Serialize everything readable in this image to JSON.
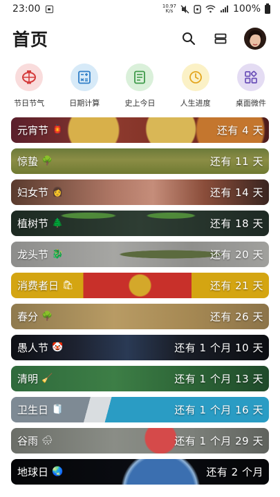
{
  "status_bar": {
    "time": "23:00",
    "net_speed_top": "10.97",
    "net_speed_bottom": "K/s",
    "battery": "100%"
  },
  "header": {
    "title": "首页"
  },
  "quick_actions": [
    {
      "label": "节日节气",
      "icon": "lantern-icon",
      "color": "#f6d9d9"
    },
    {
      "label": "日期计算",
      "icon": "calculator-icon",
      "color": "#d7e9f7"
    },
    {
      "label": "史上今日",
      "icon": "document-icon",
      "color": "#d9efd9"
    },
    {
      "label": "人生进度",
      "icon": "clock-icon",
      "color": "#faf0c8"
    },
    {
      "label": "桌面微件",
      "icon": "widgets-icon",
      "color": "#e3dcf2"
    }
  ],
  "events": [
    {
      "name": "元宵节",
      "emoji": "🏮",
      "remain": "还有 4 天"
    },
    {
      "name": "惊蛰",
      "emoji": "🌳",
      "remain": "还有 11 天"
    },
    {
      "name": "妇女节",
      "emoji": "👩",
      "remain": "还有 14 天"
    },
    {
      "name": "植树节",
      "emoji": "🌲",
      "remain": "还有 18 天"
    },
    {
      "name": "龙头节",
      "emoji": "🐉",
      "remain": "还有 20 天"
    },
    {
      "name": "消费者日",
      "emoji": "🛍",
      "remain": "还有 21 天"
    },
    {
      "name": "春分",
      "emoji": "🌳",
      "remain": "还有 26 天"
    },
    {
      "name": "愚人节",
      "emoji": "🤡",
      "remain": "还有 1 个月 10 天"
    },
    {
      "name": "清明",
      "emoji": "🧹",
      "remain": "还有 1 个月 13 天"
    },
    {
      "name": "卫生日",
      "emoji": "🧻",
      "remain": "还有 1 个月 16 天"
    },
    {
      "name": "谷雨",
      "emoji": "🌧",
      "remain": "还有 1 个月 29 天"
    },
    {
      "name": "地球日",
      "emoji": "🌏",
      "remain": "还有 2 个月"
    }
  ]
}
